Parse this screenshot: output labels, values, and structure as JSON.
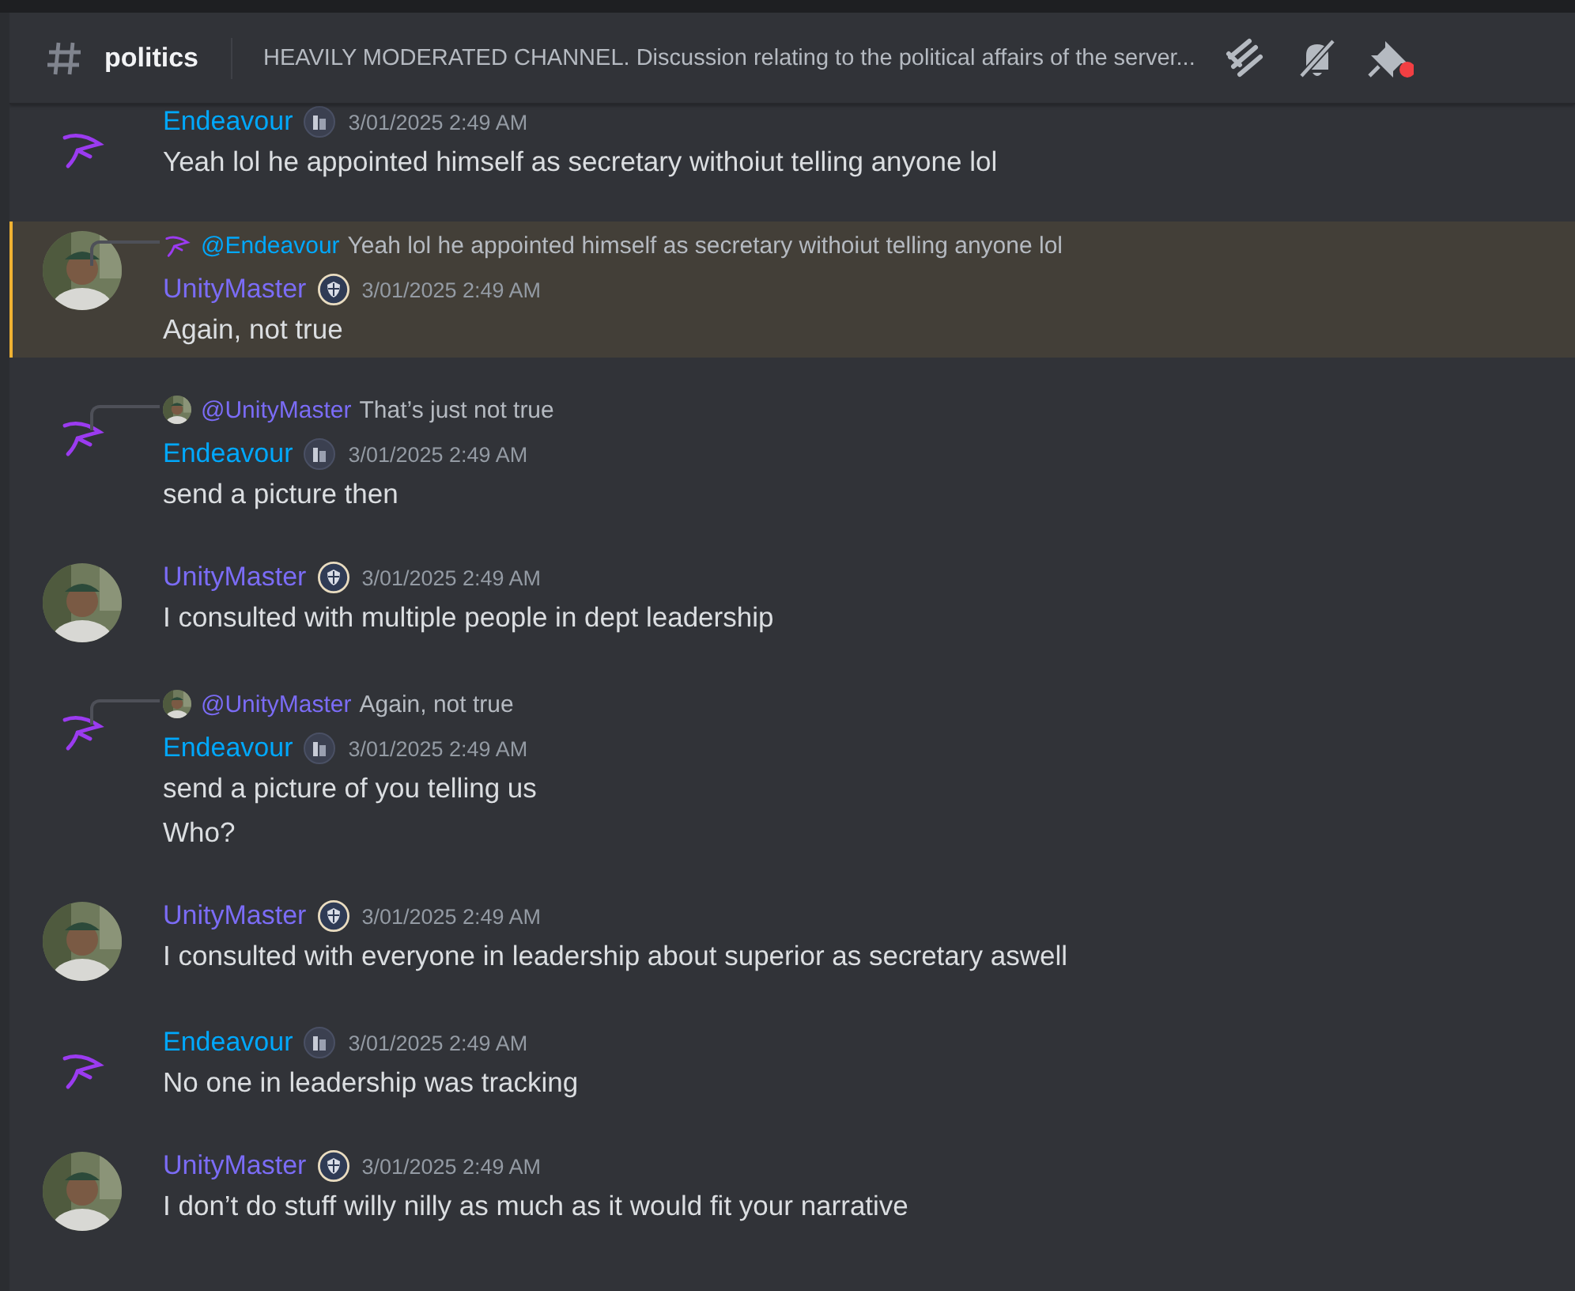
{
  "channel": {
    "name": "politics",
    "topic": "HEAVILY MODERATED CHANNEL. Discussion relating to the political affairs of the server..."
  },
  "messages": [
    {
      "author": "Endeavour",
      "kind": "squiggle",
      "color": "#00a8fc",
      "timestamp": "3/01/2025 2:49 AM",
      "highlighted": false,
      "lines": [
        "Yeah lol he appointed himself as secretary withoiut telling anyone lol"
      ]
    },
    {
      "author": "UnityMaster",
      "color": "#7b6cf6",
      "timestamp": "3/01/2025 2:49 AM",
      "highlighted": true,
      "reply": {
        "kind": "squiggle",
        "mention": "@Endeavour",
        "color": "#00a8fc",
        "text": "Yeah lol he appointed himself as secretary withoiut telling anyone lol"
      },
      "lines": [
        "Again, not true"
      ]
    },
    {
      "author": "Endeavour",
      "kind": "squiggle",
      "color": "#00a8fc",
      "timestamp": "3/01/2025 2:49 AM",
      "highlighted": false,
      "reply": {
        "mention": "@UnityMaster",
        "color": "#7b6cf6",
        "text": "That’s just not true"
      },
      "lines": [
        "send a picture then"
      ]
    },
    {
      "author": "UnityMaster",
      "color": "#7b6cf6",
      "timestamp": "3/01/2025 2:49 AM",
      "highlighted": false,
      "lines": [
        "I consulted with multiple people in dept leadership"
      ]
    },
    {
      "author": "Endeavour",
      "kind": "squiggle",
      "color": "#00a8fc",
      "timestamp": "3/01/2025 2:49 AM",
      "highlighted": false,
      "reply": {
        "mention": "@UnityMaster",
        "color": "#7b6cf6",
        "text": "Again, not true"
      },
      "lines": [
        "send a picture of you telling us",
        "Who?"
      ]
    },
    {
      "author": "UnityMaster",
      "color": "#7b6cf6",
      "timestamp": "3/01/2025 2:49 AM",
      "highlighted": false,
      "lines": [
        "I consulted with everyone in leadership about superior as secretary aswell"
      ]
    },
    {
      "author": "Endeavour",
      "kind": "squiggle",
      "color": "#00a8fc",
      "timestamp": "3/01/2025 2:49 AM",
      "highlighted": false,
      "lines": [
        "No one in leadership was tracking"
      ]
    },
    {
      "author": "UnityMaster",
      "color": "#7b6cf6",
      "timestamp": "3/01/2025 2:49 AM",
      "highlighted": false,
      "lines": [
        "I don’t do stuff willy nilly as much as it would fit your narrative"
      ]
    }
  ]
}
